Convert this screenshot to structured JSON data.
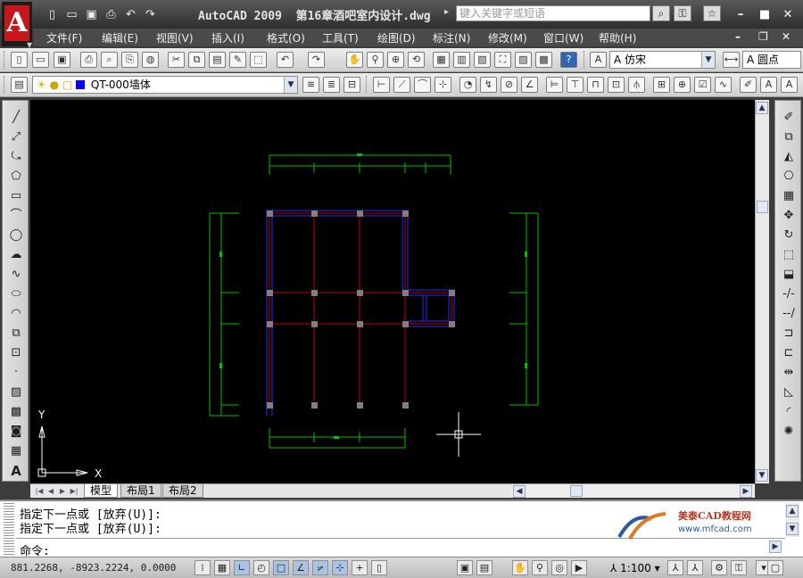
{
  "title": {
    "app_name": "AutoCAD 2009",
    "file_name": "第16章酒吧室内设计.dwg",
    "search_placeholder": "键入关键字或短语"
  },
  "menu": {
    "items": [
      "文件(F)",
      "编辑(E)",
      "视图(V)",
      "插入(I)",
      "格式(O)",
      "工具(T)",
      "绘图(D)",
      "标注(N)",
      "修改(M)",
      "窗口(W)",
      "帮助(H)"
    ]
  },
  "toolbar": {
    "text_style": "仿宋",
    "dim_style": "圆点",
    "layer": "QT-000墙体",
    "layer_color": "#0000ff"
  },
  "ucs": {
    "y_label": "Y",
    "x_label": "X"
  },
  "tabs": [
    "模型",
    "布局1",
    "布局2"
  ],
  "command": {
    "history": [
      "指定下一点或 [放弃(U)]:",
      "指定下一点或 [放弃(U)]:"
    ],
    "prompt": "命令:"
  },
  "watermark": {
    "title": "美泰CAD教程网",
    "url": "www.mfcad.com"
  },
  "status": {
    "coordinates": "881.2268,   -8923.2224, 0.0000",
    "annotation_scale": "1:100"
  },
  "colors": {
    "background": "#000000",
    "dimension": "#00c000",
    "axis": "#c00000",
    "wall": "#2a2aff",
    "grip": "#808080"
  }
}
